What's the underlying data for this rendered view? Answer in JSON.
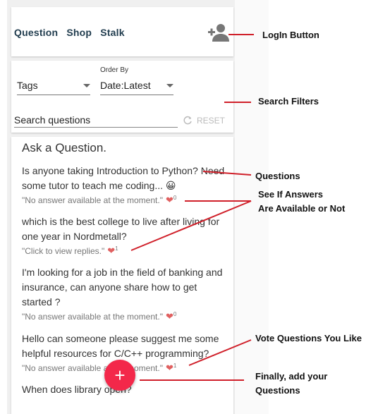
{
  "header": {
    "brand_words": [
      "Question",
      "Shop",
      "Stalk"
    ],
    "login_icon": "person-add-icon"
  },
  "filters": {
    "tags_value": "Tags",
    "order_label": "Order By",
    "order_value": "Date:Latest",
    "search_placeholder": "Search questions",
    "reset_label": "RESET"
  },
  "feed": {
    "title": "Ask a Question.",
    "questions": [
      {
        "text": "Is anyone taking Introduction to Python? Need some tutor to teach me coding...",
        "emoji": "😀",
        "status": "\"No answer available at the moment.\"",
        "votes": "0"
      },
      {
        "text": "which is the best college to live after living for one year in Nordmetall?",
        "status": "\"Click to view replies.\"",
        "votes": "1"
      },
      {
        "text": "I'm looking for a job in the field of banking and insurance, can anyone share how to get started ?",
        "status": "\"No answer available at the moment.\"",
        "votes": "0"
      },
      {
        "text": "Hello can someone please suggest me some helpful resources for C/C++ programming?",
        "status": "\"No answer available at the moment.\"",
        "votes": "1"
      },
      {
        "text": "When does library open?",
        "status": "",
        "votes": ""
      }
    ]
  },
  "fab": {
    "icon": "plus-icon",
    "label": "+"
  },
  "annotations": {
    "login": "LogIn Button",
    "filters": "Search Filters",
    "questions": "Questions",
    "answers_line1": "See If Answers",
    "answers_line2": "Are Available or Not",
    "vote": "Vote Questions You Like",
    "add_line1": "Finally, add your",
    "add_line2": "Questions"
  },
  "colors": {
    "accent": "#f3284a",
    "annotation_line": "#d0202a",
    "heart": "#e06060"
  }
}
